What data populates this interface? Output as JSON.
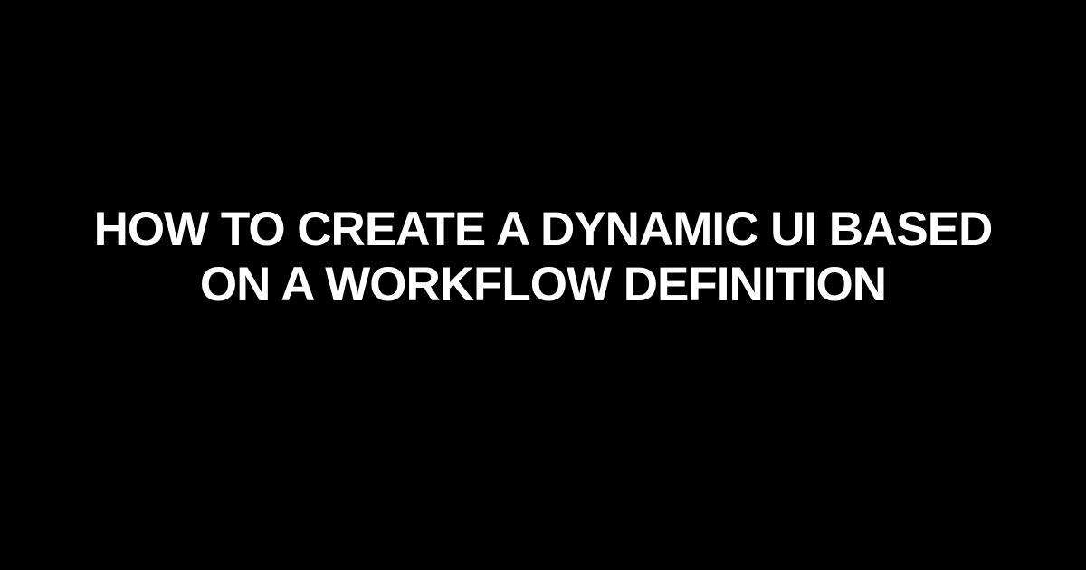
{
  "title": "How to Create a Dynamic UI Based on a Workflow Definition"
}
